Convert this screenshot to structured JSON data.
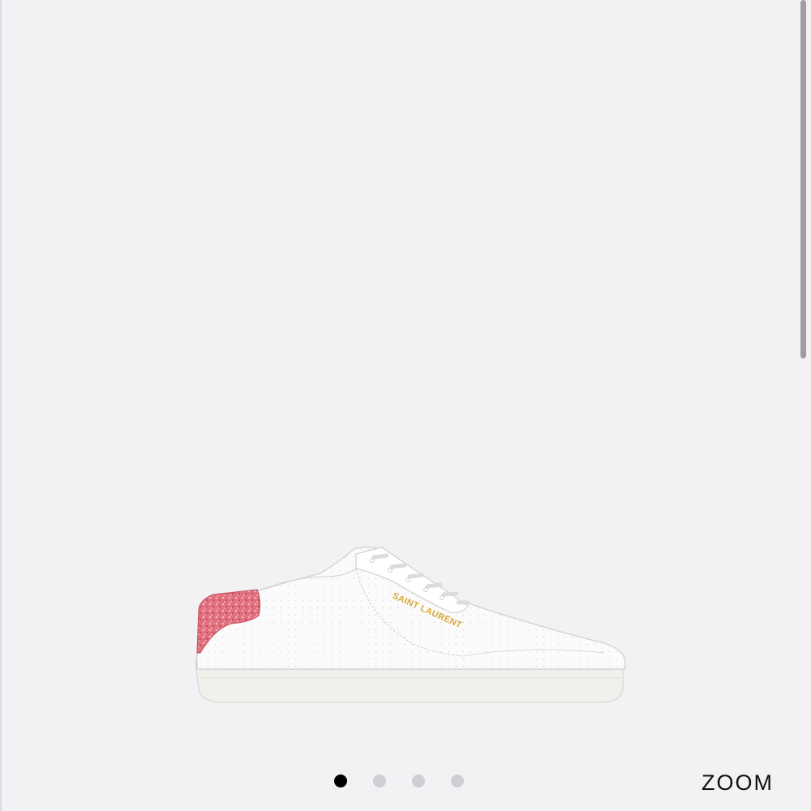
{
  "product": {
    "image_name": "white-leather-sneaker-pink-glitter-heel",
    "brand_print": "SAINT LAURENT",
    "colors": {
      "upper": "#fbfbfb",
      "heel_glitter": "#e0707e",
      "logo_gold": "#d8a93a",
      "sole": "#f1f0ec"
    }
  },
  "carousel": {
    "total": 4,
    "active_index": 0
  },
  "zoom": {
    "label": "ZOOM"
  },
  "theme": {
    "background": "#f2f2f4",
    "dot_active": "#000000",
    "dot_inactive": "#cfcfd3"
  }
}
